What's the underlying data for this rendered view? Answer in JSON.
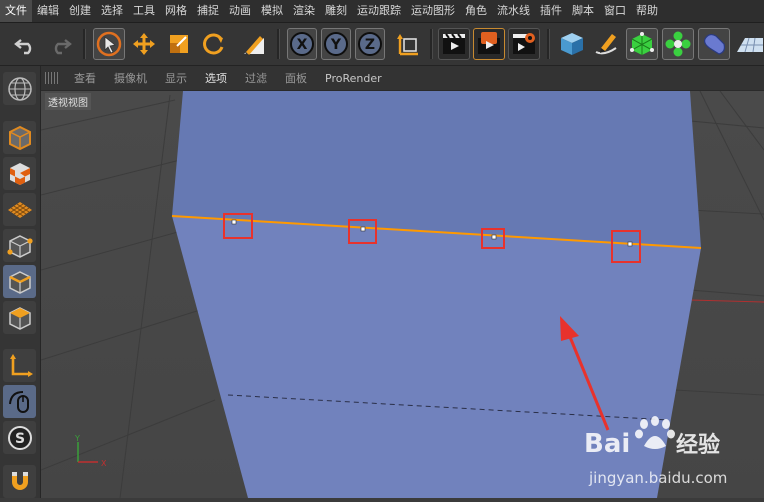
{
  "menubar": {
    "items": [
      "文件",
      "编辑",
      "创建",
      "选择",
      "工具",
      "网格",
      "捕捉",
      "动画",
      "模拟",
      "渲染",
      "雕刻",
      "运动跟踪",
      "运动图形",
      "角色",
      "流水线",
      "插件",
      "脚本",
      "窗口",
      "帮助"
    ],
    "active_index": 0
  },
  "toolbar": {
    "axis_x": "X",
    "axis_y": "Y",
    "axis_z": "Z"
  },
  "left_palette": {
    "gizmo_label": "S"
  },
  "viewport_menu": {
    "items": [
      "查看",
      "摄像机",
      "显示",
      "选项",
      "过滤",
      "面板",
      "ProRender"
    ],
    "active_index": 3
  },
  "viewport": {
    "label": "透视视图",
    "axis_y_label": "Y",
    "axis_x_label": "X",
    "object_color": "#7182bd",
    "highlight_color": "#ff9900",
    "annotation_color": "#e8322c"
  },
  "watermark": {
    "brand_left": "Bai",
    "brand_right": "经验",
    "url": "jingyan.baidu.com"
  }
}
